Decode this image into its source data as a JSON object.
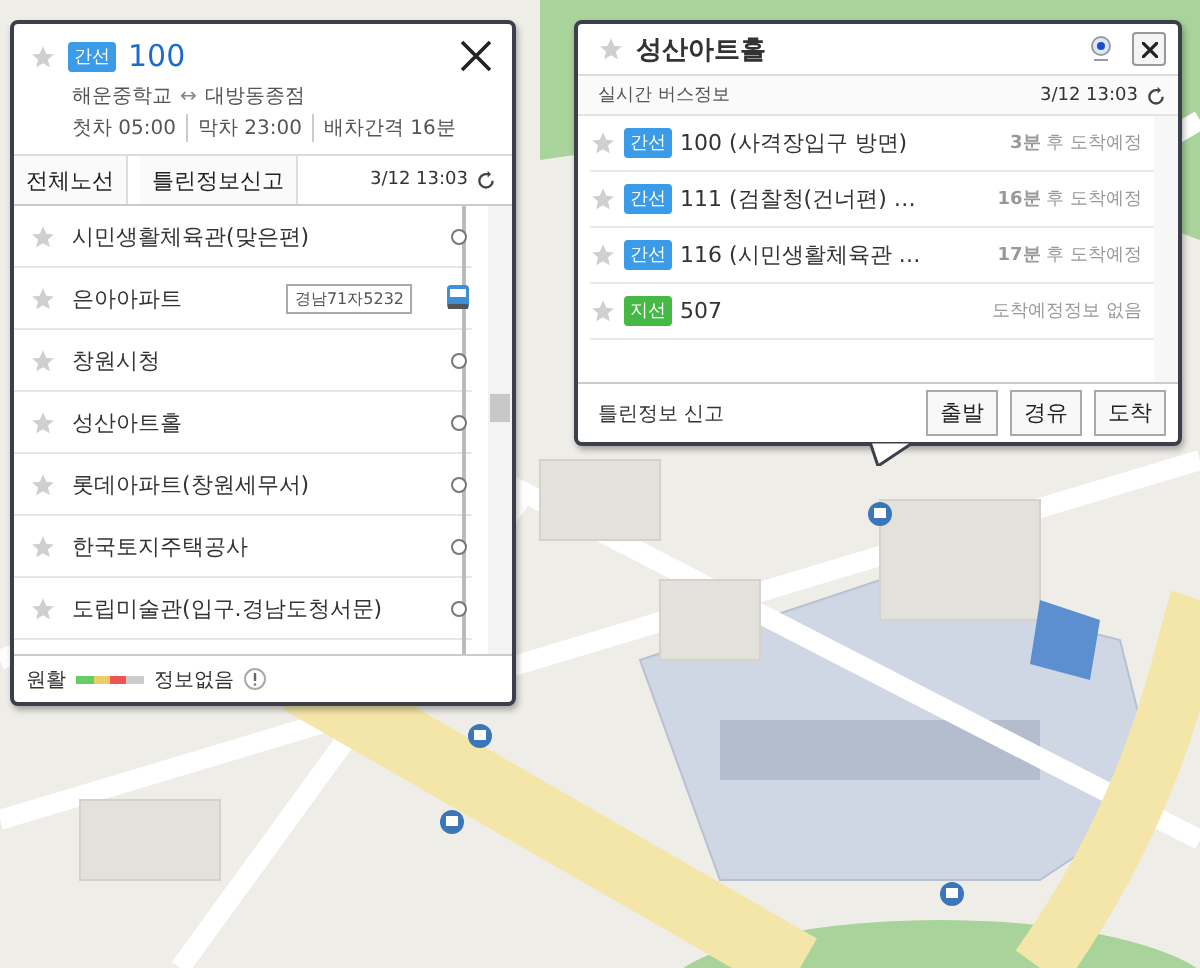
{
  "route_panel": {
    "favorite": false,
    "badge": {
      "label": "간선",
      "color": "#3a9ce8"
    },
    "route_number": "100",
    "endpoints": {
      "from": "해운중학교",
      "arrow": "↔",
      "to": "대방동종점"
    },
    "schedule": [
      "첫차 05:00",
      "막차 23:00",
      "배차간격 16분"
    ],
    "actions": [
      "전체노선",
      "틀린정보신고"
    ],
    "updated": "3/12 13:03",
    "stops": [
      {
        "name": "시민생활체육관(맞은편)",
        "favorite": false
      },
      {
        "name": "은아아파트",
        "favorite": false,
        "plate": "경남71자5232"
      },
      {
        "name": "창원시청",
        "favorite": false
      },
      {
        "name": "성산아트홀",
        "favorite": false
      },
      {
        "name": "롯데아파트(창원세무서)",
        "favorite": false
      },
      {
        "name": "한국토지주택공사",
        "favorite": false
      },
      {
        "name": "도립미술관(입구.경남도청서문)",
        "favorite": false
      }
    ],
    "legend": {
      "smooth": "원활",
      "no_info": "정보없음"
    }
  },
  "stop_panel": {
    "favorite": false,
    "title": "성산아트홀",
    "subtitle": "실시간 버스정보",
    "updated": "3/12 13:03",
    "arrivals": [
      {
        "favorite": false,
        "badge": "간선",
        "color": "#3a9ce8",
        "route": "100 (사격장입구 방면)",
        "eta": "**3분** 후 도착예정"
      },
      {
        "favorite": false,
        "badge": "간선",
        "color": "#3a9ce8",
        "route": "111 (검찰청(건너편) …",
        "eta": "**16분** 후 도착예정"
      },
      {
        "favorite": false,
        "badge": "간선",
        "color": "#3a9ce8",
        "route": "116 (시민생활체육관 …",
        "eta": "**17분** 후 도착예정"
      },
      {
        "favorite": false,
        "badge": "지선",
        "color": "#44b944",
        "route": "507",
        "eta": "도착예정정보 없음"
      }
    ],
    "report": "틀린정보 신고",
    "buttons": [
      "출발",
      "경유",
      "도착"
    ]
  }
}
